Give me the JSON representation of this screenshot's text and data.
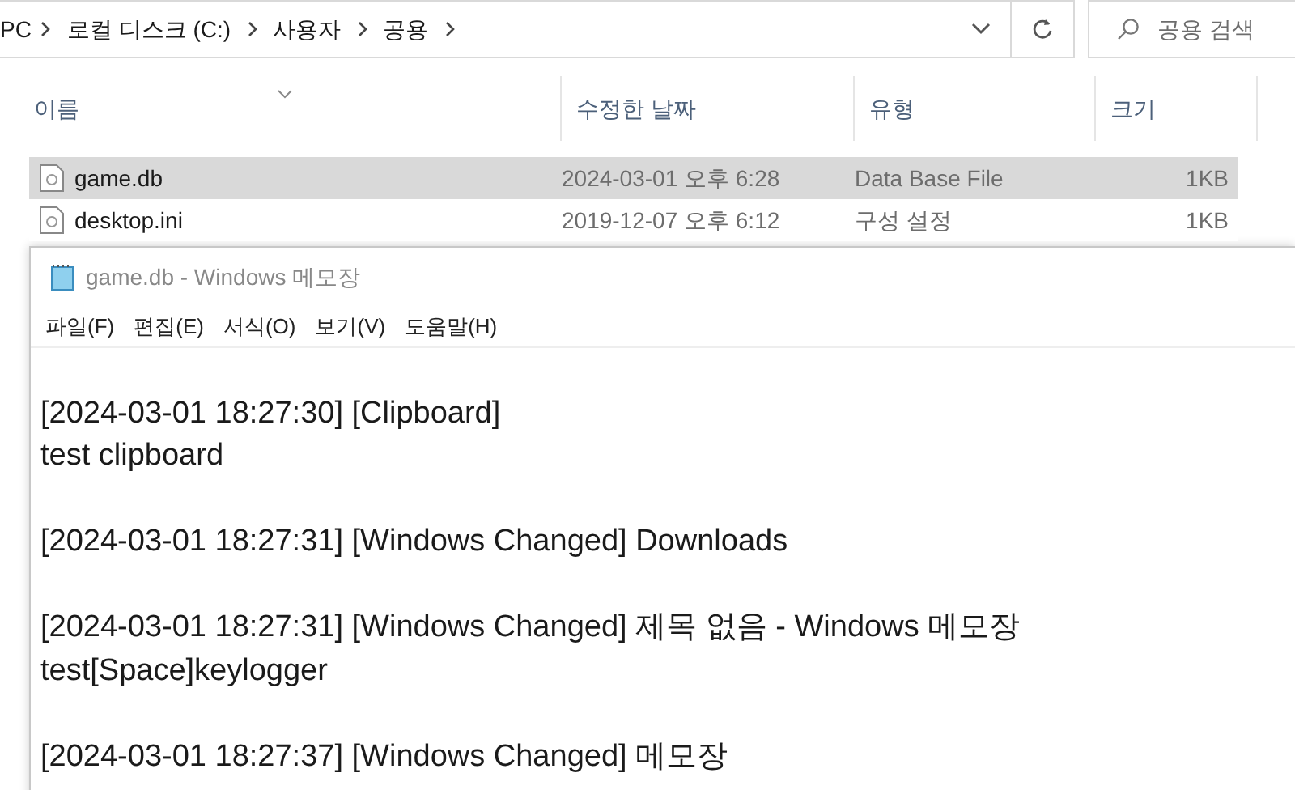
{
  "address_bar": {
    "crumbs": [
      "PC",
      "로컬 디스크 (C:)",
      "사용자",
      "공용"
    ]
  },
  "search": {
    "placeholder": "공용 검색"
  },
  "file_list": {
    "columns": [
      "이름",
      "수정한 날짜",
      "유형",
      "크기"
    ],
    "rows": [
      {
        "name": "game.db",
        "modified": "2024-03-01 오후 6:28",
        "type": "Data Base File",
        "size": "1KB",
        "selected": true
      },
      {
        "name": "desktop.ini",
        "modified": "2019-12-07 오후 6:12",
        "type": "구성 설정",
        "size": "1KB",
        "selected": false
      }
    ]
  },
  "notepad": {
    "title": "game.db - Windows 메모장",
    "menu": [
      "파일(F)",
      "편집(E)",
      "서식(O)",
      "보기(V)",
      "도움말(H)"
    ],
    "entries": [
      {
        "lines": [
          "[2024-03-01 18:27:30] [Clipboard]",
          "test clipboard"
        ]
      },
      {
        "lines": [
          "[2024-03-01 18:27:31] [Windows Changed] Downloads"
        ]
      },
      {
        "lines": [
          "[2024-03-01 18:27:31] [Windows Changed] 제목 없음 - Windows 메모장",
          "test[Space]keylogger"
        ]
      },
      {
        "lines": [
          "[2024-03-01 18:27:37] [Windows Changed] 메모장"
        ]
      }
    ]
  }
}
